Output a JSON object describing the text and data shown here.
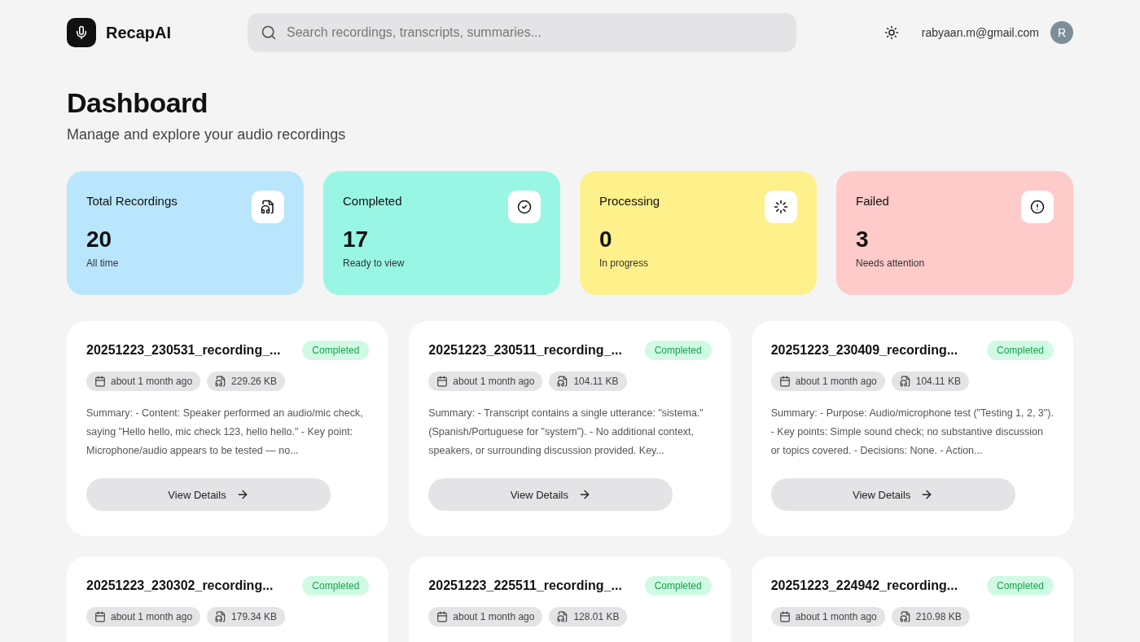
{
  "header": {
    "brand": "RecapAI",
    "search": {
      "placeholder": "Search recordings, transcripts, summaries..."
    },
    "user_email": "rabyaan.m@gmail.com",
    "avatar_initial": "R"
  },
  "page": {
    "title": "Dashboard",
    "subtitle": "Manage and explore your audio recordings"
  },
  "stats": [
    {
      "kind": "total",
      "label": "Total Recordings",
      "value": "20",
      "caption": "All time",
      "color": "#bae6fd"
    },
    {
      "kind": "completed",
      "label": "Completed",
      "value": "17",
      "caption": "Ready to view",
      "color": "#99f6e4"
    },
    {
      "kind": "processing",
      "label": "Processing",
      "value": "0",
      "caption": "In progress",
      "color": "#fef08a"
    },
    {
      "kind": "failed",
      "label": "Failed",
      "value": "3",
      "caption": "Needs attention",
      "color": "#fecaca"
    }
  ],
  "recordings": [
    {
      "title": "20251223_230531_recording_...",
      "status": {
        "kind": "completed",
        "label": "Completed"
      },
      "date": "about 1 month ago",
      "size": "229.26 KB",
      "summary": "Summary: - Content: Speaker performed an audio/mic check, saying \"Hello hello, mic check 123, hello hello.\" - Key point: Microphone/audio appears to be tested — no...",
      "action": "View Details"
    },
    {
      "title": "20251223_230511_recording_...",
      "status": {
        "kind": "completed",
        "label": "Completed"
      },
      "date": "about 1 month ago",
      "size": "104.11 KB",
      "summary": "Summary: - Transcript contains a single utterance: \"sistema.\" (Spanish/Portuguese for \"system\"). - No additional context, speakers, or surrounding discussion provided. Key...",
      "action": "View Details"
    },
    {
      "title": "20251223_230409_recording...",
      "status": {
        "kind": "completed",
        "label": "Completed"
      },
      "date": "about 1 month ago",
      "size": "104.11 KB",
      "summary": "Summary: - Purpose: Audio/microphone test (\"Testing 1, 2, 3\"). - Key points: Simple sound check; no substantive discussion or topics covered. - Decisions: None. - Action...",
      "action": "View Details"
    },
    {
      "title": "20251223_230302_recording...",
      "status": {
        "kind": "completed",
        "label": "Completed"
      },
      "date": "about 1 month ago",
      "size": "179.34 KB"
    },
    {
      "title": "20251223_225511_recording_...",
      "status": {
        "kind": "completed",
        "label": "Completed"
      },
      "date": "about 1 month ago",
      "size": "128.01 KB"
    },
    {
      "title": "20251223_224942_recording...",
      "status": {
        "kind": "completed",
        "label": "Completed"
      },
      "date": "about 1 month ago",
      "size": "210.98 KB"
    }
  ]
}
